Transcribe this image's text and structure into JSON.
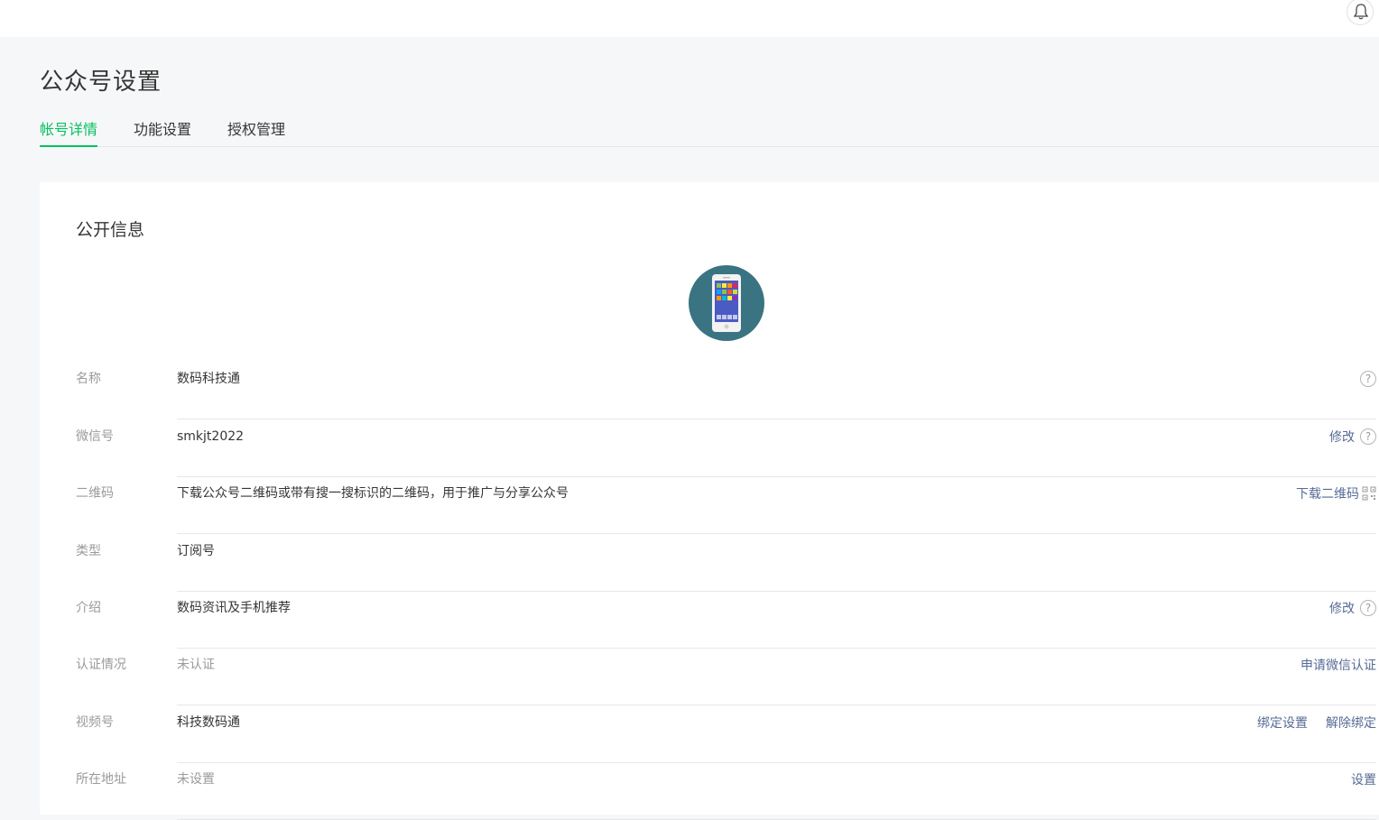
{
  "page": {
    "title": "公众号设置"
  },
  "tabs": [
    {
      "label": "帐号详情",
      "active": true
    },
    {
      "label": "功能设置",
      "active": false
    },
    {
      "label": "授权管理",
      "active": false
    }
  ],
  "section": {
    "title": "公开信息"
  },
  "rows": {
    "name": {
      "label": "名称",
      "value": "数码科技通"
    },
    "wechat_id": {
      "label": "微信号",
      "value": "smkjt2022",
      "action": "修改"
    },
    "qrcode": {
      "label": "二维码",
      "value": "下载公众号二维码或带有搜一搜标识的二维码，用于推广与分享公众号",
      "action": "下载二维码"
    },
    "type": {
      "label": "类型",
      "value": "订阅号"
    },
    "intro": {
      "label": "介绍",
      "value": "数码资讯及手机推荐",
      "action": "修改"
    },
    "verification": {
      "label": "认证情况",
      "value": "未认证",
      "action": "申请微信认证"
    },
    "channels": {
      "label": "视频号",
      "value": "科技数码通",
      "action1": "绑定设置",
      "action2": "解除绑定"
    },
    "address": {
      "label": "所在地址",
      "value": "未设置",
      "action": "设置"
    }
  },
  "help_glyph": "?",
  "colors": {
    "accent": "#07c160",
    "link": "#576b95",
    "avatar_bg": "#3a7482"
  },
  "icons": [
    "bell-icon",
    "phone-icon",
    "help-icon",
    "qrcode-icon"
  ]
}
